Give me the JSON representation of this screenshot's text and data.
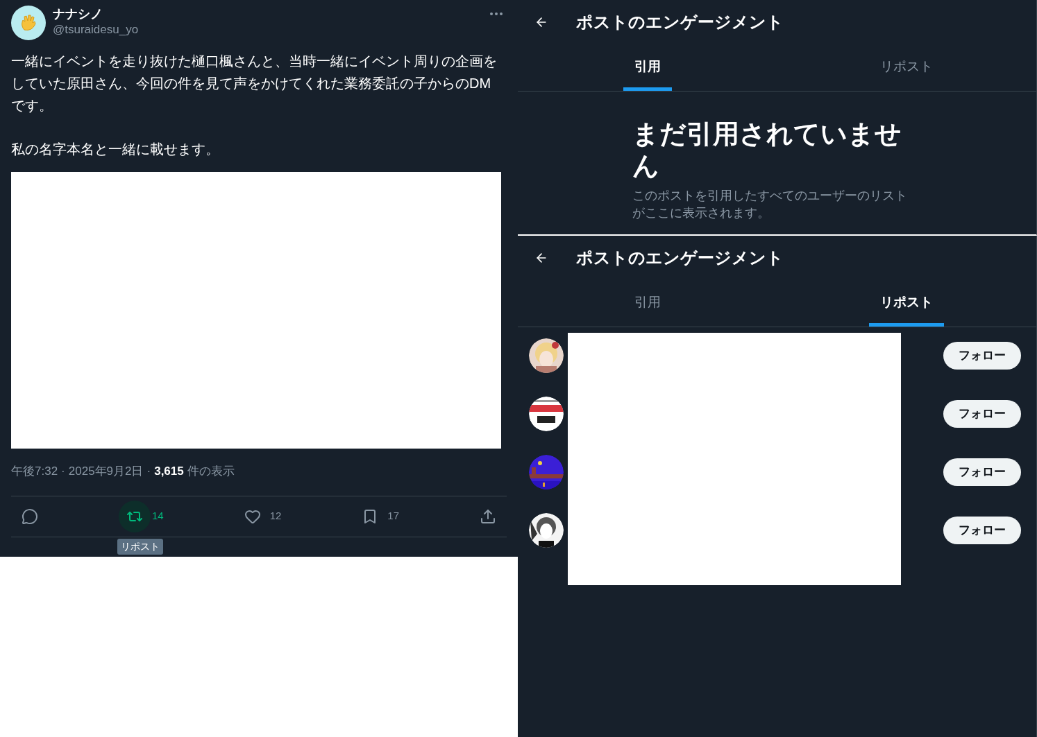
{
  "post": {
    "author": {
      "name": "ナナシノ",
      "handle": "@tsuraidesu_yo"
    },
    "body": [
      "一緒にイベントを走り抜けた樋口楓さんと、当時一緒にイベント周りの企画をしていた原田さん、今回の件を見て声をかけてくれた業務委託の子からのDMです。",
      "私の名字本名と一緒に載せます。"
    ],
    "meta": {
      "time": "午後7:32",
      "separator": "·",
      "date": "2025年9月2日",
      "separator_2": "·",
      "views": "3,615",
      "views_label": "件の表示"
    },
    "actions": [
      {
        "kind": "reply",
        "active": false
      },
      {
        "kind": "repost",
        "count": "14",
        "active": true
      },
      {
        "kind": "like",
        "count": "12",
        "active": false
      },
      {
        "kind": "bookmark",
        "count": "17",
        "active": false
      },
      {
        "kind": "share",
        "active": false
      }
    ],
    "tooltip": "リポスト"
  },
  "panels": [
    {
      "title": "ポストのエンゲージメント",
      "tabs": [
        {
          "label": "引用",
          "selected": true
        },
        {
          "label": "リポスト",
          "selected": false
        }
      ],
      "content": {
        "kind": "empty",
        "heading": "まだ引用されていません",
        "description": "このポストを引用したすべてのユーザーのリストがここに表示されます。"
      }
    },
    {
      "title": "ポストのエンゲージメント",
      "tabs": [
        {
          "label": "引用",
          "selected": false
        },
        {
          "label": "リポスト",
          "selected": true
        }
      ],
      "content": {
        "kind": "users",
        "users": [
          {
            "follow": "フォロー"
          },
          {
            "follow": "フォロー"
          },
          {
            "follow": "フォロー"
          },
          {
            "follow": "フォロー"
          }
        ]
      }
    }
  ]
}
